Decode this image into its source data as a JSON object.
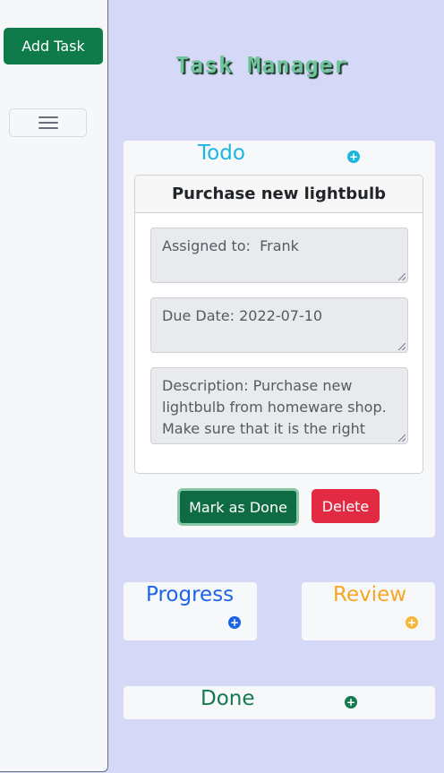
{
  "sidebar": {
    "add_task_label": "Add Task",
    "menu_icon": "hamburger-menu-icon"
  },
  "header": {
    "title": "Task Manager"
  },
  "columns": {
    "todo": {
      "title": "Todo",
      "color": "#1bb6e0"
    },
    "progress": {
      "title": "Progress",
      "color": "#1c63e6"
    },
    "review": {
      "title": "Review",
      "color": "#f6a623"
    },
    "done": {
      "title": "Done",
      "color": "#157a4d"
    }
  },
  "task": {
    "title": "Purchase new lightbulb",
    "assigned": "Assigned to:  Frank",
    "due": "Due Date: 2022-07-10",
    "description": "Description: Purchase new lightbulb from homeware shop. Make sure that it is the right size and type.",
    "done_label": "Mark as Done",
    "delete_label": "Delete"
  },
  "colors": {
    "background": "#d6d8f8",
    "primary_green": "#0f7a4a",
    "danger": "#e22b43"
  }
}
